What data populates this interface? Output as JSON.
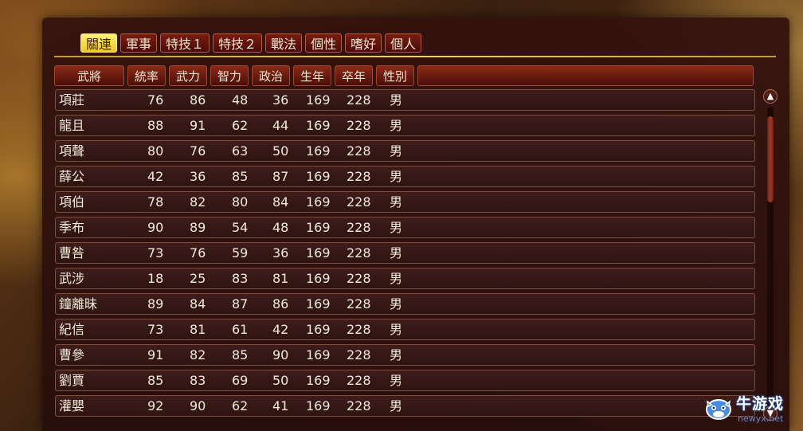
{
  "tabs": [
    {
      "label": "關連",
      "active": true
    },
    {
      "label": "軍事",
      "active": false
    },
    {
      "label": "特技１",
      "active": false
    },
    {
      "label": "特技２",
      "active": false
    },
    {
      "label": "戰法",
      "active": false
    },
    {
      "label": "個性",
      "active": false
    },
    {
      "label": "嗜好",
      "active": false
    },
    {
      "label": "個人",
      "active": false
    }
  ],
  "columns": [
    "武將",
    "統率",
    "武力",
    "智力",
    "政治",
    "生年",
    "卒年",
    "性別"
  ],
  "officers": [
    {
      "name": "項莊",
      "lead": "76",
      "war": "86",
      "int": "48",
      "pol": "36",
      "born": "169",
      "died": "228",
      "sex": "男"
    },
    {
      "name": "龍且",
      "lead": "88",
      "war": "91",
      "int": "62",
      "pol": "44",
      "born": "169",
      "died": "228",
      "sex": "男"
    },
    {
      "name": "項聲",
      "lead": "80",
      "war": "76",
      "int": "63",
      "pol": "50",
      "born": "169",
      "died": "228",
      "sex": "男"
    },
    {
      "name": "薛公",
      "lead": "42",
      "war": "36",
      "int": "85",
      "pol": "87",
      "born": "169",
      "died": "228",
      "sex": "男"
    },
    {
      "name": "項伯",
      "lead": "78",
      "war": "82",
      "int": "80",
      "pol": "84",
      "born": "169",
      "died": "228",
      "sex": "男"
    },
    {
      "name": "季布",
      "lead": "90",
      "war": "89",
      "int": "54",
      "pol": "48",
      "born": "169",
      "died": "228",
      "sex": "男"
    },
    {
      "name": "曹咎",
      "lead": "73",
      "war": "76",
      "int": "59",
      "pol": "36",
      "born": "169",
      "died": "228",
      "sex": "男"
    },
    {
      "name": "武涉",
      "lead": "18",
      "war": "25",
      "int": "83",
      "pol": "81",
      "born": "169",
      "died": "228",
      "sex": "男"
    },
    {
      "name": "鐘離昧",
      "lead": "89",
      "war": "84",
      "int": "87",
      "pol": "86",
      "born": "169",
      "died": "228",
      "sex": "男"
    },
    {
      "name": "紀信",
      "lead": "73",
      "war": "81",
      "int": "61",
      "pol": "42",
      "born": "169",
      "died": "228",
      "sex": "男"
    },
    {
      "name": "曹參",
      "lead": "91",
      "war": "82",
      "int": "85",
      "pol": "90",
      "born": "169",
      "died": "228",
      "sex": "男"
    },
    {
      "name": "劉賈",
      "lead": "85",
      "war": "83",
      "int": "69",
      "pol": "50",
      "born": "169",
      "died": "228",
      "sex": "男"
    },
    {
      "name": "灌嬰",
      "lead": "92",
      "war": "90",
      "int": "62",
      "pol": "41",
      "born": "169",
      "died": "228",
      "sex": "男"
    }
  ],
  "scrollbar": {
    "up_icon": "chevron-up-icon",
    "down_icon": "chevron-down-icon",
    "position": 0.0
  },
  "watermark": {
    "title": "牛游戏",
    "url": "newyx.net",
    "icon": "cow-face-icon"
  },
  "colors": {
    "active_tab": "#f2c820",
    "panel": "#34120e",
    "header": "#7a1c10",
    "gold_line": "#e8c048",
    "text": "#f2ead8"
  }
}
